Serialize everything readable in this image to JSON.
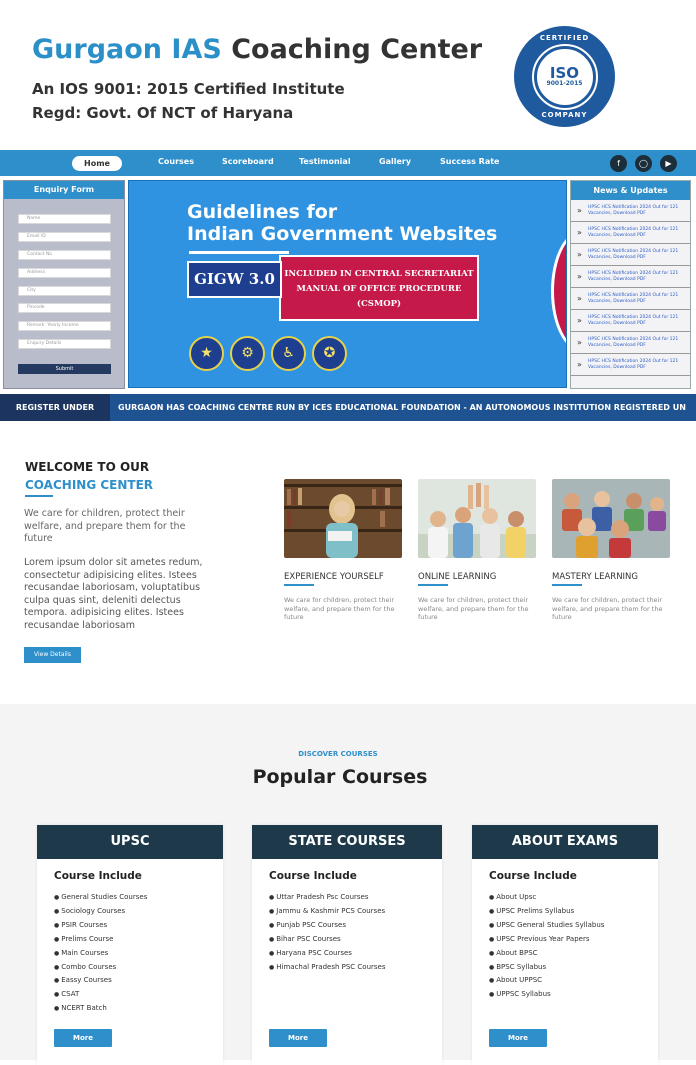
{
  "header": {
    "title_part1": "Gurgaon IAS",
    "title_part2": "Coaching Center",
    "subtitle1": "An IOS 9001: 2015 Certified Institute",
    "subtitle2": "Regd: Govt. Of NCT of Haryana",
    "seal": {
      "top": "CERTIFIED",
      "iso": "ISO",
      "year": "9001-2015",
      "bottom": "COMPANY"
    }
  },
  "nav": {
    "items": [
      "Home",
      "Courses",
      "Scoreboard",
      "Testimonial",
      "Gallery",
      "Success Rate"
    ],
    "social": [
      "facebook-icon",
      "instagram-icon",
      "youtube-icon"
    ]
  },
  "enquiry": {
    "title": "Enquiry Form",
    "fields": [
      "Name",
      "Email ID",
      "Contact No",
      "Address",
      "City",
      "Pincode",
      "Remark: Yearly Income",
      "Enquiry Details"
    ],
    "submit": "Submit"
  },
  "banner": {
    "heading_line1": "Guidelines for",
    "heading_line2": "Indian Government Websites",
    "badge": "GIGW 3.0",
    "notice": "INCLUDED IN CENTRAL SECRETARIAT MANUAL OF OFFICE PROCEDURE (CSMOP)"
  },
  "news": {
    "title": "News & Updates",
    "items": [
      "HPSC HCS Notification 2024 Out for 121 Vacancies, Download PDF",
      "HPSC HCS Notification 2024 Out for 121 Vacancies, Download PDF",
      "HPSC HCS Notification 2024 Out for 121 Vacancies, Download PDF",
      "HPSC HCS Notification 2024 Out for 121 Vacancies, Download PDF",
      "HPSC HCS Notification 2024 Out for 121 Vacancies, Download PDF",
      "HPSC HCS Notification 2024 Out for 121 Vacancies, Download PDF",
      "HPSC HCS Notification 2024 Out for 121 Vacancies, Download PDF",
      "HPSC HCS Notification 2024 Out for 121 Vacancies, Download PDF"
    ]
  },
  "ticker": {
    "label": "REGISTER UNDER",
    "message": "GURGAON HAS COACHING CENTRE RUN BY ICES EDUCATIONAL FOUNDATION - AN AUTONOMOUS INSTITUTION REGISTERED UN"
  },
  "welcome": {
    "line1": "WELCOME TO OUR",
    "line2": "COACHING CENTER",
    "lead": "We care for children, protect their welfare, and prepare them for the future",
    "body": "Lorem ipsum dolor sit ametes redum, consectetur adipisicing elites. Istees recusandae laboriosam, voluptatibus culpa quas sint, deleniti delectus tempora. adipisicing elites. Istees recusandae laboriosam",
    "button": "View Details"
  },
  "features": [
    {
      "title": "EXPERIENCE YOURSELF",
      "desc": "We care for children, protect their welfare, and prepare them for the future"
    },
    {
      "title": "ONLINE LEARNING",
      "desc": "We care for children, protect their welfare, and prepare them for the future"
    },
    {
      "title": "MASTERY LEARNING",
      "desc": "We care for children, protect their welfare, and prepare them for the future"
    }
  ],
  "courses": {
    "eyebrow": "DISCOVER COURSES",
    "title": "Popular Courses",
    "cards": [
      {
        "header": "UPSC",
        "subtitle": "Course Include",
        "items": [
          "General Studies Courses",
          "Sociology Courses",
          "PSIR Courses",
          "Prelims Course",
          "Main Courses",
          "Combo Courses",
          "Eassy Courses",
          "CSAT",
          "NCERT Batch"
        ],
        "button": "More"
      },
      {
        "header": "STATE COURSES",
        "subtitle": "Course Include",
        "items": [
          "Uttar Pradesh Psc Courses",
          "Jammu & Kashmir PCS Courses",
          "Punjab PSC Courses",
          "Bihar PSC Courses",
          "Haryana PSC Courses",
          "Himachal Pradesh PSC Courses"
        ],
        "button": "More"
      },
      {
        "header": "ABOUT EXAMS",
        "subtitle": "Course Include",
        "items": [
          "About Upsc",
          "UPSC Prelims Syllabus",
          "UPSC General Studies Syllabus",
          "UPSC Previous Year Papers",
          "About BPSC",
          "BPSC Syllabus",
          "About UPPSC",
          "UPPSC Syllabus"
        ],
        "button": "More"
      }
    ]
  }
}
